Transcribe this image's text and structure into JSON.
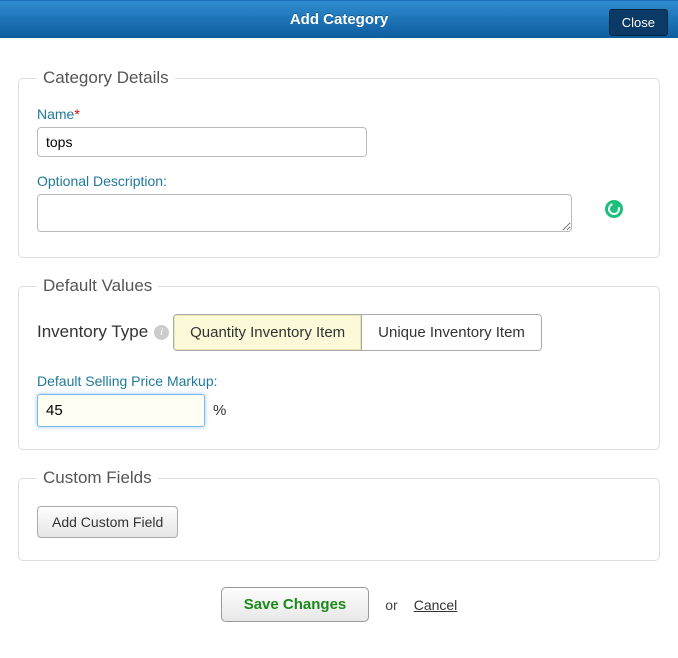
{
  "header": {
    "title": "Add Category",
    "close": "Close"
  },
  "categoryDetails": {
    "legend": "Category Details",
    "nameLabel": "Name",
    "nameValue": "tops",
    "descriptionLabel": "Optional Description:",
    "descriptionValue": ""
  },
  "defaultValues": {
    "legend": "Default Values",
    "inventoryTypeLabel": "Inventory Type",
    "options": {
      "quantity": "Quantity Inventory Item",
      "unique": "Unique Inventory Item"
    },
    "markupLabel": "Default Selling Price Markup:",
    "markupValue": "45",
    "markupUnit": "%"
  },
  "customFields": {
    "legend": "Custom Fields",
    "addButton": "Add Custom Field"
  },
  "footer": {
    "save": "Save Changes",
    "or": "or",
    "cancel": "Cancel"
  }
}
